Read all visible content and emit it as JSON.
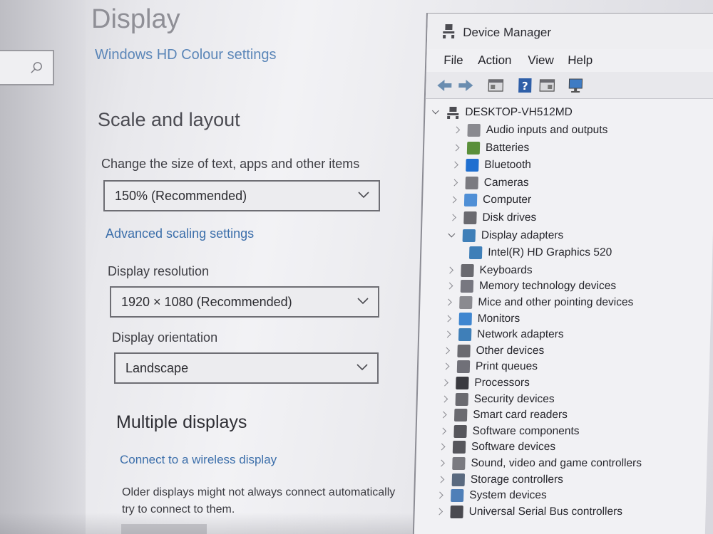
{
  "settings": {
    "page_title": "Display",
    "hd_colour_link": "Windows HD Colour settings",
    "scale_section_title": "Scale and layout",
    "scale_label": "Change the size of text, apps and other items",
    "scale_value": "150% (Recommended)",
    "advanced_scaling_link": "Advanced scaling settings",
    "resolution_label": "Display resolution",
    "resolution_value": "1920 × 1080 (Recommended)",
    "orientation_label": "Display orientation",
    "orientation_value": "Landscape",
    "multiple_displays_title": "Multiple displays",
    "wireless_display_link": "Connect to a wireless display",
    "older_displays_text_line1": "Older displays might not always connect automatically",
    "older_displays_text_line2": "try to connect to them.",
    "search_icon": "search-icon"
  },
  "device_manager": {
    "window_title": "Device Manager",
    "menu": [
      "File",
      "Action",
      "View",
      "Help"
    ],
    "toolbar_icons": [
      "back-icon",
      "forward-icon",
      "properties-icon",
      "help-icon",
      "details-icon",
      "monitor-icon"
    ],
    "root": "DESKTOP-VH512MD",
    "categories": [
      {
        "label": "Audio inputs and outputs",
        "icon": "speaker-icon",
        "expanded": false
      },
      {
        "label": "Batteries",
        "icon": "battery-icon",
        "expanded": false
      },
      {
        "label": "Bluetooth",
        "icon": "bluetooth-icon",
        "expanded": false
      },
      {
        "label": "Cameras",
        "icon": "camera-icon",
        "expanded": false
      },
      {
        "label": "Computer",
        "icon": "computer-icon",
        "expanded": false
      },
      {
        "label": "Disk drives",
        "icon": "disk-icon",
        "expanded": false
      },
      {
        "label": "Display adapters",
        "icon": "display-adapter-icon",
        "expanded": true
      },
      {
        "label": "Intel(R) HD Graphics 520",
        "icon": "display-adapter-icon",
        "child": true
      },
      {
        "label": "Keyboards",
        "icon": "keyboard-icon",
        "expanded": false
      },
      {
        "label": "Memory technology devices",
        "icon": "memory-icon",
        "expanded": false
      },
      {
        "label": "Mice and other pointing devices",
        "icon": "mouse-icon",
        "expanded": false
      },
      {
        "label": "Monitors",
        "icon": "monitor-icon",
        "expanded": false
      },
      {
        "label": "Network adapters",
        "icon": "network-icon",
        "expanded": false
      },
      {
        "label": "Other devices",
        "icon": "other-devices-icon",
        "expanded": false
      },
      {
        "label": "Print queues",
        "icon": "printer-icon",
        "expanded": false
      },
      {
        "label": "Processors",
        "icon": "processor-icon",
        "expanded": false
      },
      {
        "label": "Security devices",
        "icon": "security-icon",
        "expanded": false
      },
      {
        "label": "Smart card readers",
        "icon": "smart-card-icon",
        "expanded": false
      },
      {
        "label": "Software components",
        "icon": "software-component-icon",
        "expanded": false
      },
      {
        "label": "Software devices",
        "icon": "software-device-icon",
        "expanded": false
      },
      {
        "label": "Sound, video and game controllers",
        "icon": "sound-icon",
        "expanded": false
      },
      {
        "label": "Storage controllers",
        "icon": "storage-icon",
        "expanded": false
      },
      {
        "label": "System devices",
        "icon": "system-icon",
        "expanded": false
      },
      {
        "label": "Universal Serial Bus controllers",
        "icon": "usb-icon",
        "expanded": false
      }
    ]
  },
  "colors": {
    "link_blue": "#3b6eaa",
    "accent_blue": "#2f6fb8"
  }
}
